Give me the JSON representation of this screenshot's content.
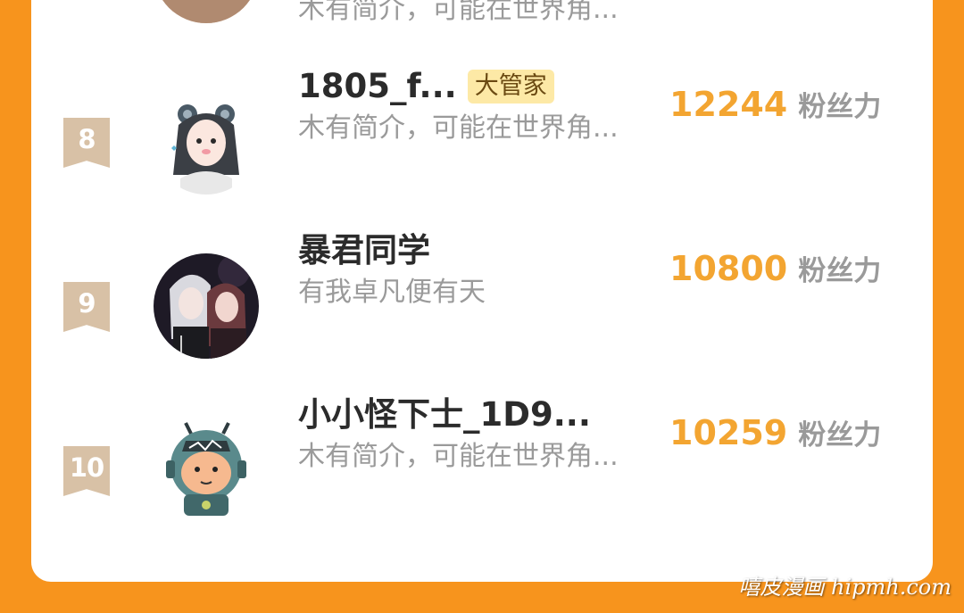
{
  "colors": {
    "background": "#f7941d",
    "card": "#ffffff",
    "fans_number": "#f3a531",
    "rank_ribbon": "#d8c1a6",
    "badge_bg": "#fde9a6"
  },
  "ranking": {
    "previous_row": {
      "bio": "木有简介，可能在世界角..."
    },
    "rows": [
      {
        "rank": "8",
        "name": "1805_f...",
        "badge": "大管家",
        "bio": "木有简介，可能在世界角...",
        "fans": "12244",
        "fans_unit": "粉丝力",
        "avatar_icon": "girl-bear-ears-avatar-icon"
      },
      {
        "rank": "9",
        "name": "暴君同学",
        "bio": "有我卓凡便有天",
        "fans": "10800",
        "fans_unit": "粉丝力",
        "avatar_icon": "anime-couple-avatar-icon"
      },
      {
        "rank": "10",
        "name": "小小怪下士_1D9...",
        "bio": "木有简介，可能在世界角...",
        "fans": "10259",
        "fans_unit": "粉丝力",
        "avatar_icon": "helmet-character-avatar-icon"
      }
    ]
  },
  "watermark": "嘻皮漫画 hipmh.com"
}
